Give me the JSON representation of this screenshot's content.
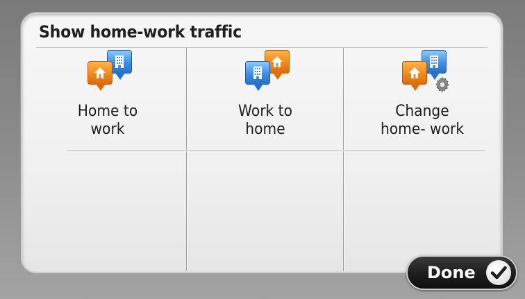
{
  "panel": {
    "title": "Show home-work traffic"
  },
  "options": [
    {
      "label_line1": "Home to",
      "label_line2": "work",
      "front_icon": "home-icon",
      "back_icon": "office-building-icon"
    },
    {
      "label_line1": "Work to",
      "label_line2": "home",
      "front_icon": "office-building-icon",
      "back_icon": "home-icon"
    },
    {
      "label_line1": "Change",
      "label_line2": "home- work",
      "front_icon": "home-icon",
      "back_icon": "office-building-icon",
      "badge_icon": "gear-icon"
    }
  ],
  "done_button": {
    "label": "Done",
    "icon": "checkmark-icon"
  },
  "colors": {
    "home_pin": "#f08a1c",
    "work_pin": "#3f8fe6",
    "done_bg": "#1f1f1f"
  }
}
